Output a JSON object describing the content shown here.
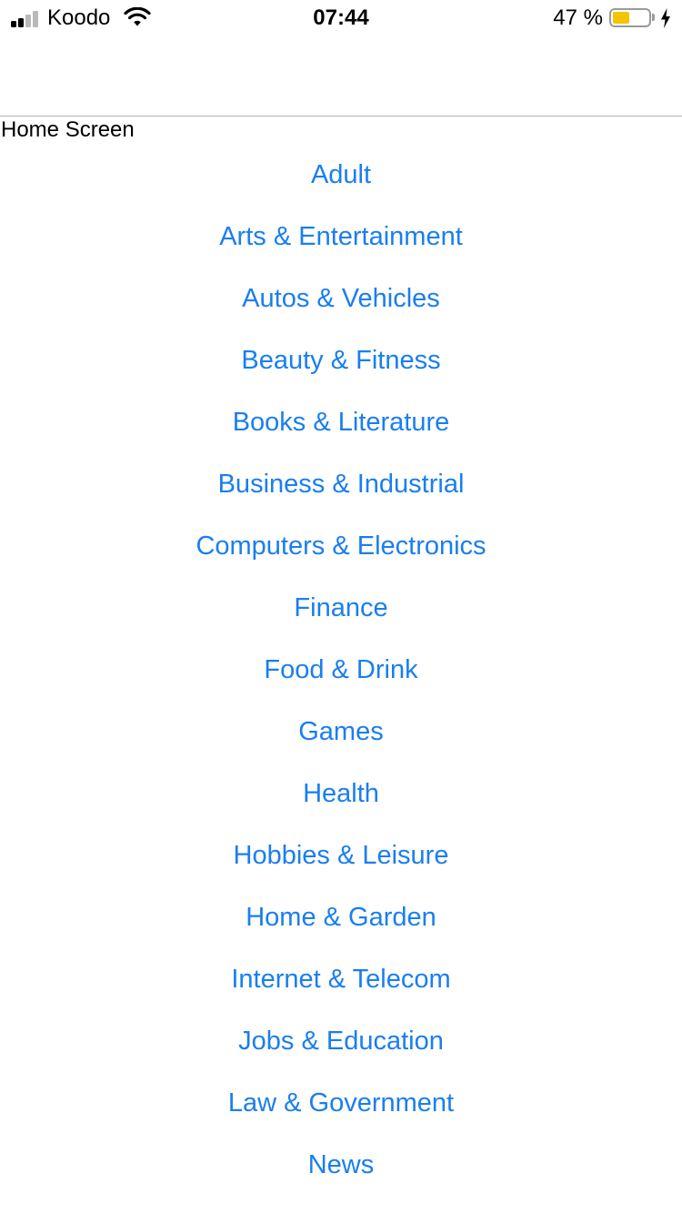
{
  "status_bar": {
    "carrier": "Koodo",
    "time": "07:44",
    "battery_percent_text": "47 %",
    "battery_level": 0.47,
    "signal_bars_active": 2,
    "signal_bars_total": 4,
    "icons": [
      "signal-icon",
      "wifi-icon",
      "battery-icon",
      "charging-bolt-icon"
    ]
  },
  "colors": {
    "link": "#1a7ef0",
    "battery_fill": "#f5c400",
    "signal_active": "#000000",
    "signal_inactive": "#b8b8b8"
  },
  "screen_label": "Home Screen",
  "categories": [
    "Adult",
    "Arts & Entertainment",
    "Autos & Vehicles",
    "Beauty & Fitness",
    "Books & Literature",
    "Business & Industrial",
    "Computers & Electronics",
    "Finance",
    "Food & Drink",
    "Games",
    "Health",
    "Hobbies & Leisure",
    "Home & Garden",
    "Internet & Telecom",
    "Jobs & Education",
    "Law & Government",
    "News"
  ]
}
